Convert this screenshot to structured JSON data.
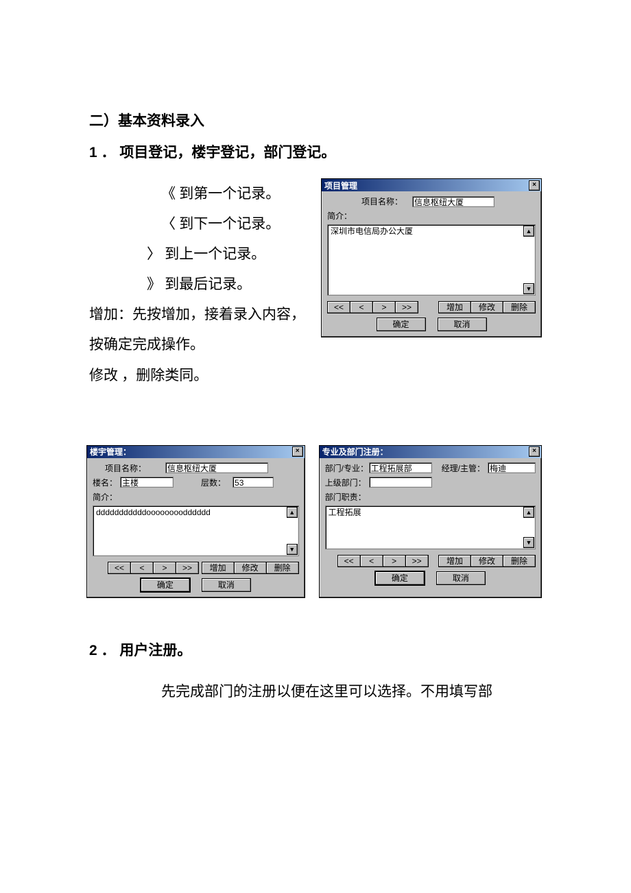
{
  "doc": {
    "section_heading": "二）基本资料录入",
    "sub_heading_1": "1 ． 项目登记，楼宇登记，部门登记。",
    "nav_first": "《   到第一个记录。",
    "nav_next": "〈     到下一个记录。",
    "nav_prev": "〉   到上一个记录。",
    "nav_last": "》   到最后记录。",
    "add_line": "增加：先按增加，接着录入内容，按确定完成操作。",
    "mod_line": "修改 ，删除类同。",
    "sub_heading_2": "2 ． 用户注册。",
    "body2": "先完成部门的注册以便在这里可以选择。不用填写部"
  },
  "common": {
    "first": "<<",
    "prev": "<",
    "next": ">",
    "last": ">>",
    "add": "增加",
    "edit": "修改",
    "del": "删除",
    "ok": "确定",
    "cancel": "取消",
    "close_glyph": "×",
    "up_glyph": "▲",
    "down_glyph": "▼"
  },
  "dlg_project": {
    "title": "项目管理",
    "name_label": "项目名称：",
    "name_value": "信息枢纽大厦",
    "intro_label": "简介：",
    "intro_value": "深圳市电信局办公大厦"
  },
  "dlg_building": {
    "title": "楼宇管理：",
    "proj_label": "项目名称：",
    "proj_value": "信息枢纽大厦",
    "name_label": "楼名：",
    "name_value": "主楼",
    "floors_label": "层数：",
    "floors_value": "53",
    "intro_label": "简介：",
    "intro_value": "dddddddddddoooooooodddddd"
  },
  "dlg_dept": {
    "title": "专业及部门注册：",
    "dept_label": "部门/专业：",
    "dept_value": "工程拓展部",
    "mgr_label": "经理/主管：",
    "mgr_value": "梅迪",
    "parent_label": "上级部门：",
    "parent_value": "",
    "duty_label": "部门职责：",
    "duty_value": "工程拓展"
  }
}
